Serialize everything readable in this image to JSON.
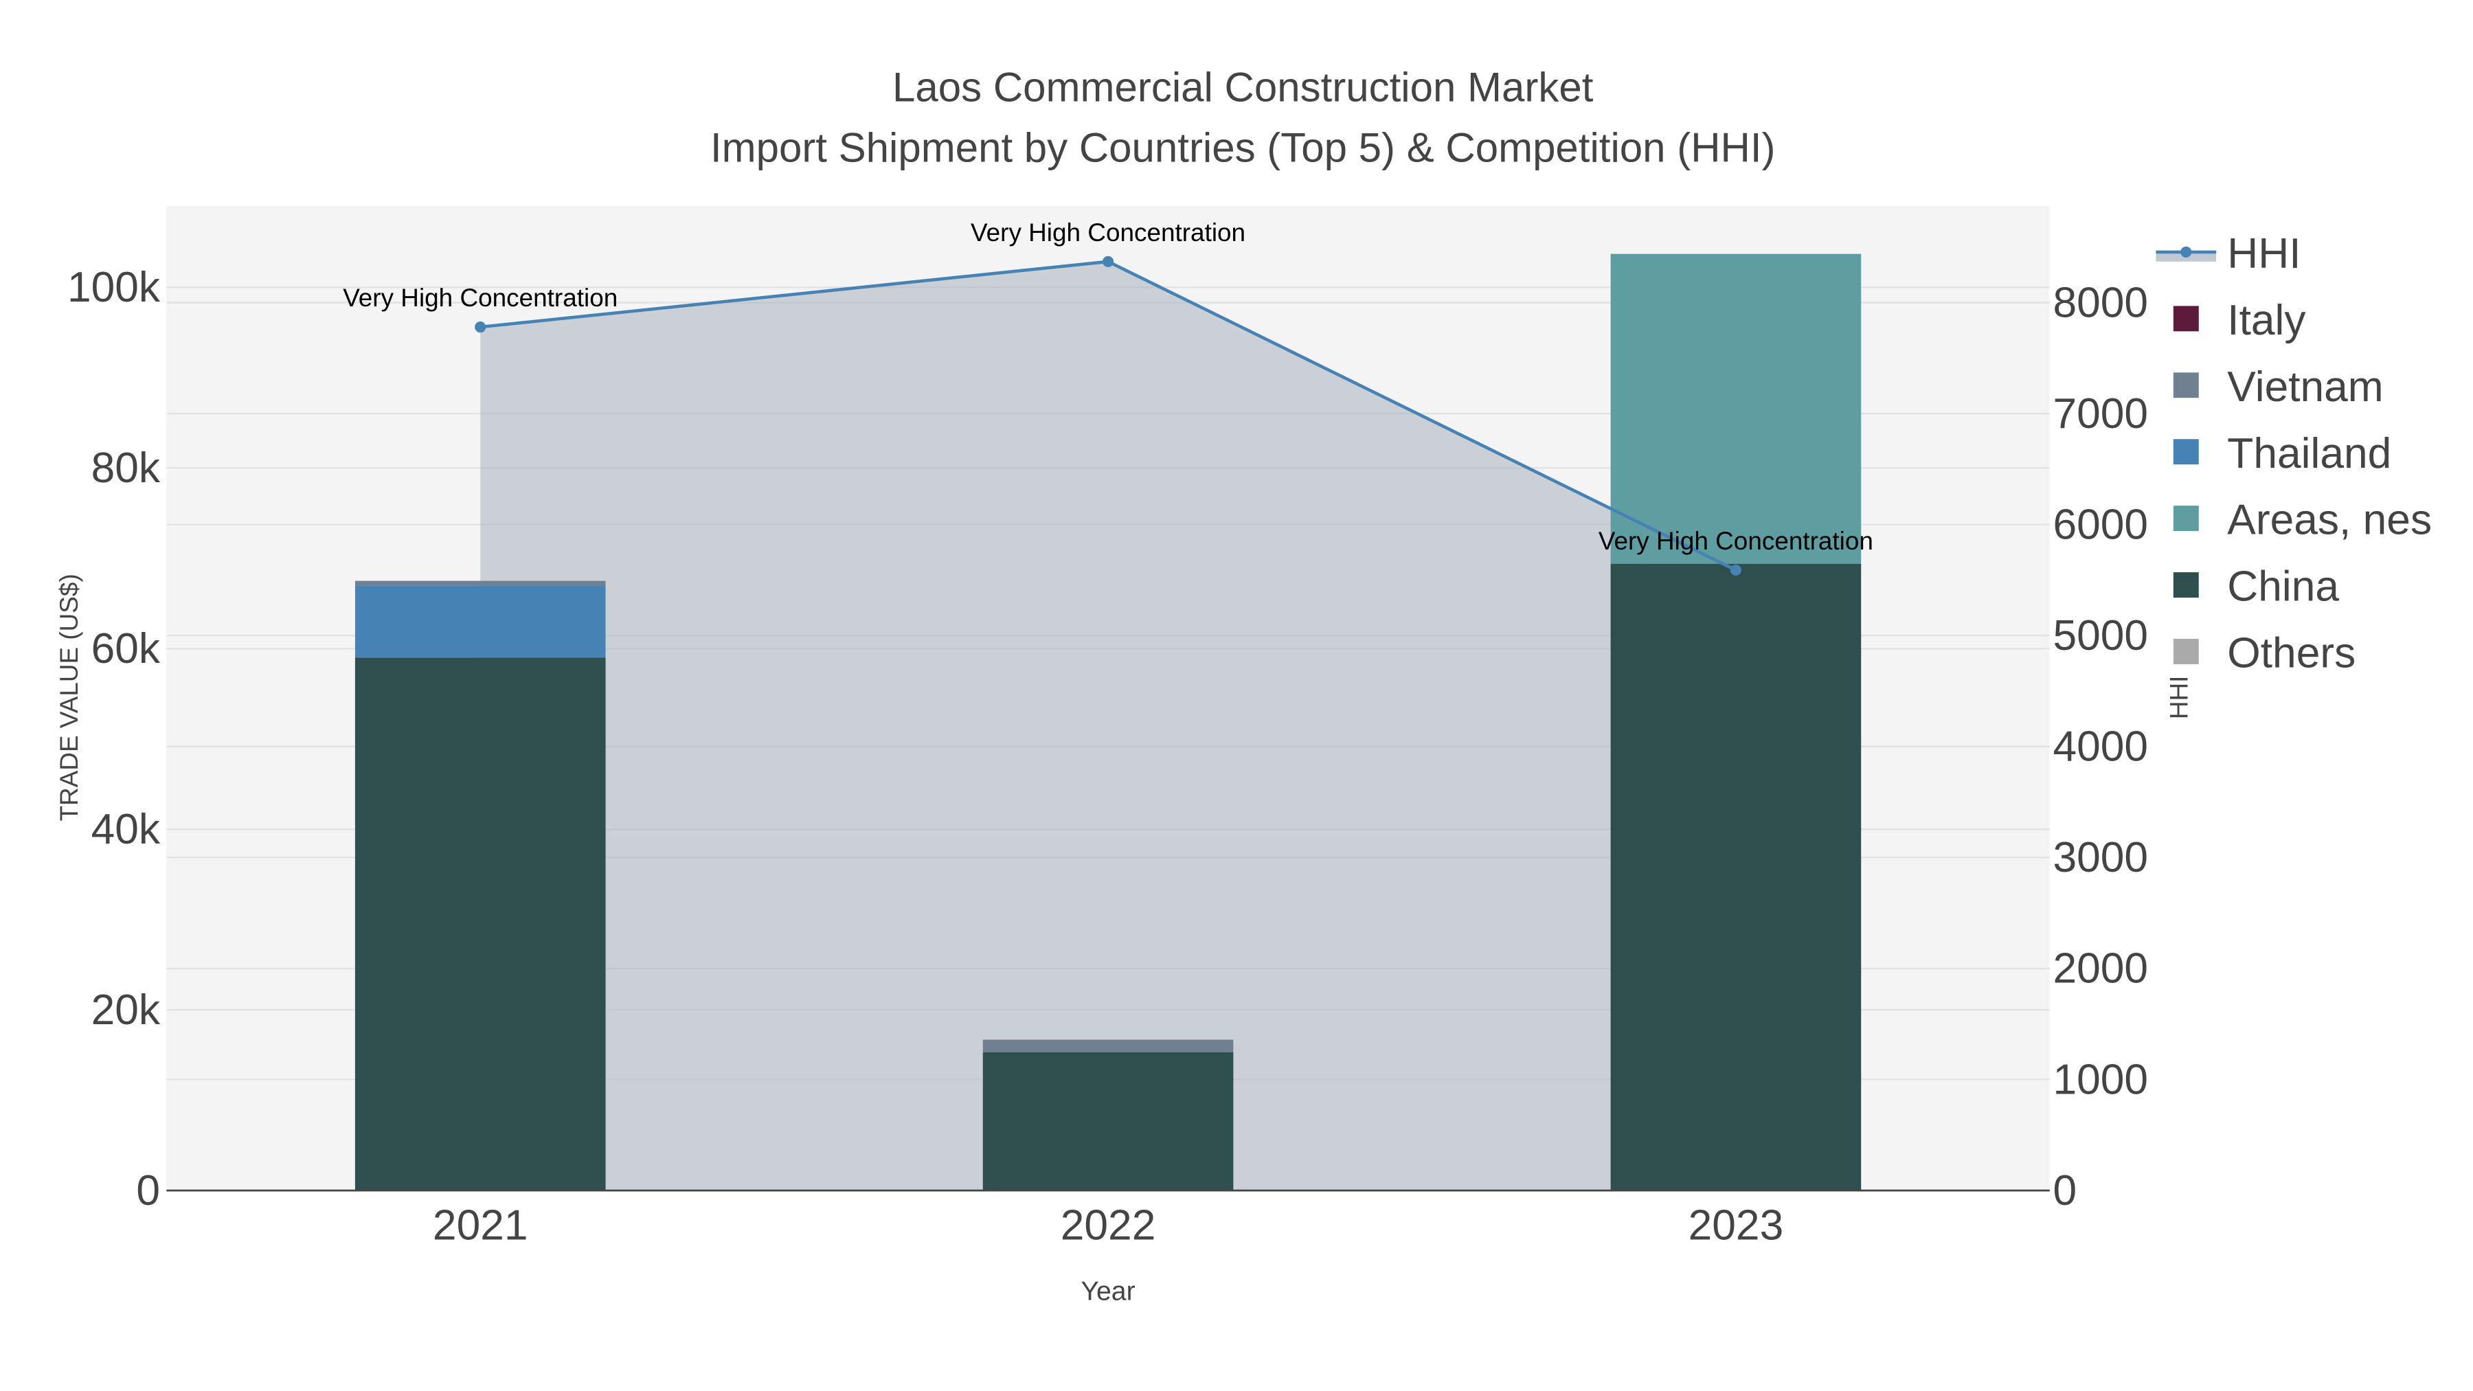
{
  "chart_data": {
    "type": "bar",
    "title": "Laos Commercial Construction Market",
    "subtitle": "Import Shipment by Countries (Top 5) & Competition (HHI)",
    "xlabel": "Year",
    "ylabel": "TRADE VALUE (US$)",
    "y2label": "HHI",
    "categories": [
      "2021",
      "2022",
      "2023"
    ],
    "ylim": [
      0,
      109000
    ],
    "y2lim": [
      0,
      8870
    ],
    "yticks": [
      0,
      20000,
      40000,
      60000,
      80000,
      100000
    ],
    "ytick_labels": [
      "0",
      "20k",
      "40k",
      "60k",
      "80k",
      "100k"
    ],
    "y2ticks": [
      0,
      1000,
      2000,
      3000,
      4000,
      5000,
      6000,
      7000,
      8000
    ],
    "y2tick_labels": [
      "0",
      "1000",
      "2000",
      "3000",
      "4000",
      "5000",
      "6000",
      "7000",
      "8000"
    ],
    "grid": true,
    "barmode": "stack",
    "legend_position": "right",
    "series": [
      {
        "name": "China",
        "color": "#2f4f4f",
        "values": [
          59000,
          15300,
          69400
        ]
      },
      {
        "name": "Areas, nes",
        "color": "#5f9ea0",
        "values": [
          0,
          0,
          34300
        ]
      },
      {
        "name": "Thailand",
        "color": "#4682b4",
        "values": [
          8000,
          0,
          0
        ]
      },
      {
        "name": "Vietnam",
        "color": "#708090",
        "values": [
          500,
          1400,
          0
        ]
      },
      {
        "name": "Italy",
        "color": "#5e1a3a",
        "values": [
          0,
          0,
          0
        ]
      },
      {
        "name": "Others",
        "color": "#aaaaaa",
        "values": [
          0,
          0,
          0
        ]
      }
    ],
    "legend_order": [
      "HHI",
      "Italy",
      "Vietnam",
      "Thailand",
      "Areas, nes",
      "China",
      "Others"
    ],
    "hhi": {
      "name": "HHI",
      "color": "#4682b4",
      "values": [
        7780,
        8370,
        5590
      ],
      "labels": [
        "Very High Concentration",
        "Very High Concentration",
        "Very High Concentration"
      ]
    }
  }
}
